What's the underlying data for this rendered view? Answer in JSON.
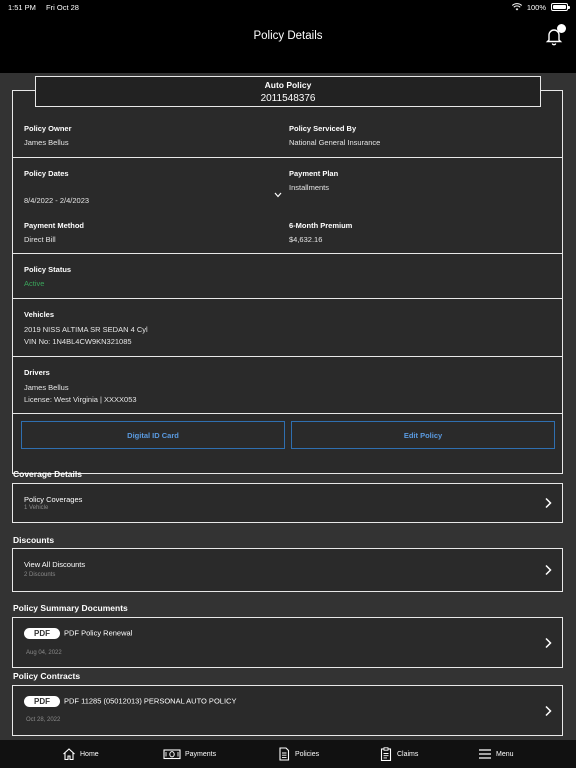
{
  "status_bar": {
    "time": "1:51 PM",
    "date": "Fri Oct 28",
    "battery": "100%"
  },
  "nav": {
    "title": "Policy Details"
  },
  "policy": {
    "type": "Auto Policy",
    "number": "2011548376",
    "owner_label": "Policy Owner",
    "owner": "James Bellus",
    "serviced_label": "Policy Serviced By",
    "serviced_by": "National General Insurance",
    "dates_label": "Policy Dates",
    "dates": "8/4/2022 - 2/4/2023",
    "payment_plan_label": "Payment Plan",
    "payment_plan": "Installments",
    "payment_method_label": "Payment Method",
    "payment_method": "Direct Bill",
    "premium_label": "6-Month Premium",
    "premium": "$4,632.16",
    "status_label": "Policy Status",
    "status": "Active",
    "vehicles_label": "Vehicles",
    "vehicle": "2019 NISS ALTIMA SR SEDAN 4 Cyl",
    "vin": "VIN No: 1N4BL4CW9KN321085",
    "drivers_label": "Drivers",
    "driver": "James Bellus",
    "license": "License: West Virginia | XXXX053",
    "id_card_button": "Digital ID Card",
    "edit_button": "Edit Policy"
  },
  "coverage": {
    "title": "Coverage Details",
    "item": "Policy Coverages",
    "sub": "1 Vehicle"
  },
  "discounts": {
    "title": "Discounts",
    "item": "View All Discounts",
    "sub": "2 Discounts"
  },
  "summary_docs": {
    "title": "Policy Summary Documents",
    "badge": "PDF",
    "item": "PDF Policy Renewal",
    "date": "Aug 04, 2022"
  },
  "contracts": {
    "title": "Policy Contracts",
    "badge": "PDF",
    "item": "PDF 11285 (05012013) PERSONAL AUTO POLICY",
    "date": "Oct 28, 2022"
  },
  "tabs": [
    {
      "label": "Home",
      "icon": "home-icon"
    },
    {
      "label": "Payments",
      "icon": "money-icon"
    },
    {
      "label": "Policies",
      "icon": "document-icon"
    },
    {
      "label": "Claims",
      "icon": "clipboard-icon"
    },
    {
      "label": "Menu",
      "icon": "hamburger-icon"
    }
  ],
  "colors": {
    "background": "#333333",
    "card": "#2a2a2a",
    "accent": "#2f6fb0",
    "active_status": "#3aa45a"
  }
}
